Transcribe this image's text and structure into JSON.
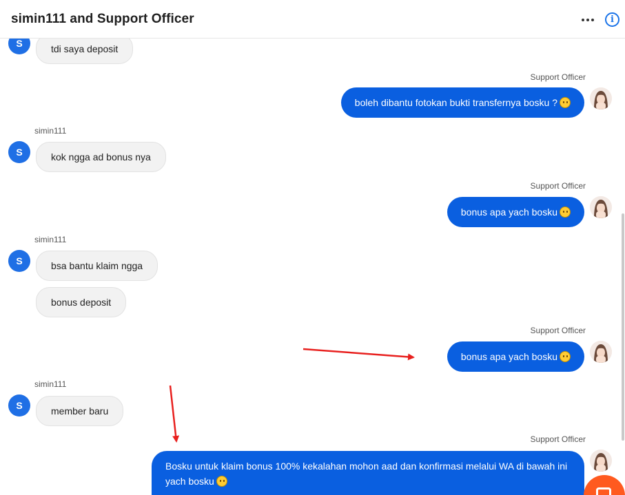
{
  "header": {
    "title": "simin111 and Support Officer",
    "more_icon": "more-horizontal-icon",
    "info_icon": "info-icon",
    "info_glyph": "i"
  },
  "colors": {
    "user_avatar": "#1f6fe5",
    "outgoing_bubble": "#0a5fe0",
    "incoming_bubble": "#f2f2f2",
    "annotation_arrow": "#e8201e",
    "launcher": "#ff5a1f"
  },
  "messages": [
    {
      "from": "user",
      "avatar_letter": "S",
      "text": "tdi saya deposit"
    },
    {
      "from": "agent",
      "sender": "Support Officer",
      "text": "boleh dibantu fotokan bukti transfernya bosku ?"
    },
    {
      "from": "user",
      "sender": "simin111",
      "avatar_letter": "S",
      "text": "kok ngga ad bonus nya"
    },
    {
      "from": "agent",
      "sender": "Support Officer",
      "text": "bonus apa yach bosku"
    },
    {
      "from": "user",
      "sender": "simin111",
      "avatar_letter": "S",
      "text": "bsa bantu klaim ngga"
    },
    {
      "from": "user",
      "text": "bonus deposit"
    },
    {
      "from": "agent",
      "sender": "Support Officer",
      "text": "bonus apa yach bosku"
    },
    {
      "from": "user",
      "sender": "simin111",
      "avatar_letter": "S",
      "text": "member baru"
    },
    {
      "from": "agent",
      "sender": "Support Officer",
      "text": "Bosku untuk klaim bonus 100% kekalahan mohon aad dan konfirmasi melalui WA di bawah ini yach bosku"
    }
  ],
  "launcher": {
    "icon": "chat-launcher-icon"
  }
}
